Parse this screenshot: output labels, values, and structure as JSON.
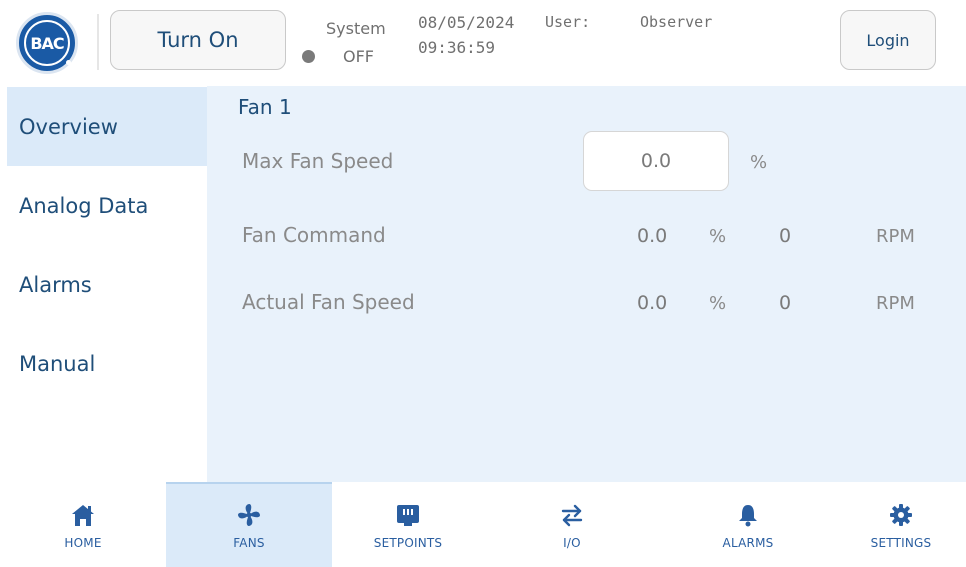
{
  "header": {
    "logo_text": "BAC",
    "turn_on_label": "Turn On",
    "system_label": "System",
    "system_status": "OFF",
    "date": "08/05/2024",
    "time": "09:36:59",
    "user_label": "User:",
    "user_value": "Observer",
    "login_label": "Login"
  },
  "sidebar": {
    "items": [
      {
        "label": "Overview",
        "active": true
      },
      {
        "label": "Analog Data",
        "active": false
      },
      {
        "label": "Alarms",
        "active": false
      },
      {
        "label": "Manual",
        "active": false
      }
    ]
  },
  "main": {
    "title": "Fan 1",
    "max_fan_speed": {
      "label": "Max Fan Speed",
      "value": "0.0",
      "unit": "%"
    },
    "fan_command": {
      "label": "Fan Command",
      "percent": "0.0",
      "percent_unit": "%",
      "rpm": "0",
      "rpm_unit": "RPM"
    },
    "actual_fan_speed": {
      "label": "Actual Fan Speed",
      "percent": "0.0",
      "percent_unit": "%",
      "rpm": "0",
      "rpm_unit": "RPM"
    }
  },
  "nav": {
    "items": [
      {
        "label": "HOME",
        "icon": "home-icon",
        "active": false
      },
      {
        "label": "FANS",
        "icon": "fan-icon",
        "active": true
      },
      {
        "label": "SETPOINTS",
        "icon": "setpoints-icon",
        "active": false
      },
      {
        "label": "I/O",
        "icon": "io-arrows-icon",
        "active": false
      },
      {
        "label": "ALARMS",
        "icon": "bell-icon",
        "active": false
      },
      {
        "label": "SETTINGS",
        "icon": "gear-icon",
        "active": false
      }
    ]
  },
  "colors": {
    "accent": "#1f4e79",
    "icon_blue": "#2a5ea0",
    "active_bg": "#dbeaf9",
    "panel_bg": "#e9f2fb",
    "status_dot": "#7a7a7a"
  }
}
